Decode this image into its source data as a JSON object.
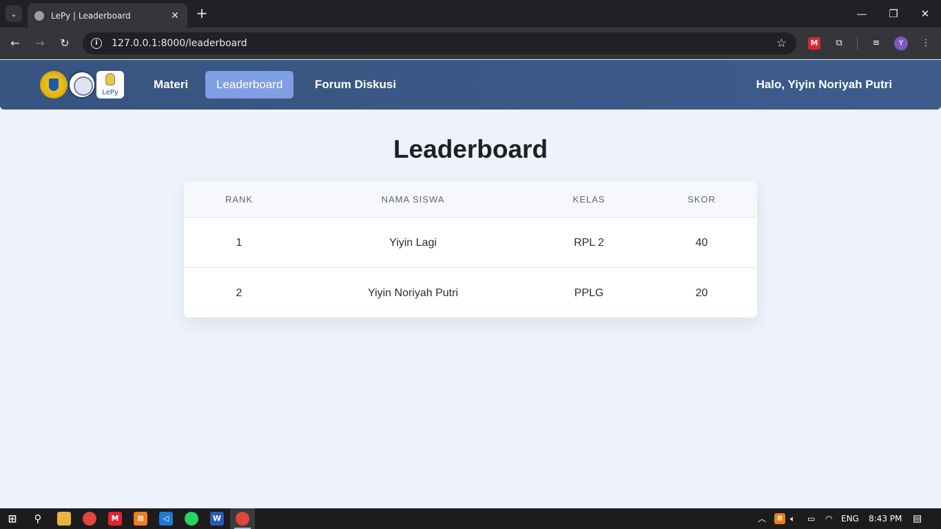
{
  "browser": {
    "tab_title": "LePy | Leaderboard",
    "tab_close": "✕",
    "new_tab": "+",
    "url": "127.0.0.1:8000/leaderboard",
    "profile_initial": "Y",
    "extension_label": "M",
    "icons": [
      "tab-search-icon",
      "back-icon",
      "forward-icon",
      "reload-icon",
      "site-info-icon",
      "bookmark-star-icon",
      "extension-icon",
      "puzzle-icon",
      "media-icon",
      "menu-icon",
      "minimize-icon",
      "restore-icon",
      "close-icon"
    ]
  },
  "nav": {
    "logo_text": "LePy",
    "links": [
      {
        "label": "Materi",
        "active": false
      },
      {
        "label": "Leaderboard",
        "active": true
      },
      {
        "label": "Forum Diskusi",
        "active": false
      }
    ],
    "greeting": "Halo, Yiyin Noriyah Putri"
  },
  "main": {
    "title": "Leaderboard",
    "table": {
      "headers": [
        "RANK",
        "NAMA SISWA",
        "KELAS",
        "SKOR"
      ],
      "rows": [
        [
          "1",
          "Yiyin Lagi",
          "RPL 2",
          "40"
        ],
        [
          "2",
          "Yiyin Noriyah Putri",
          "PPLG",
          "20"
        ]
      ]
    }
  },
  "taskbar": {
    "language": "ENG",
    "time": "8:43 PM"
  },
  "colors": {
    "nav_bg": "#3a5785",
    "active_link": "#7f9ee3",
    "page_bg": "#eef2fa"
  }
}
